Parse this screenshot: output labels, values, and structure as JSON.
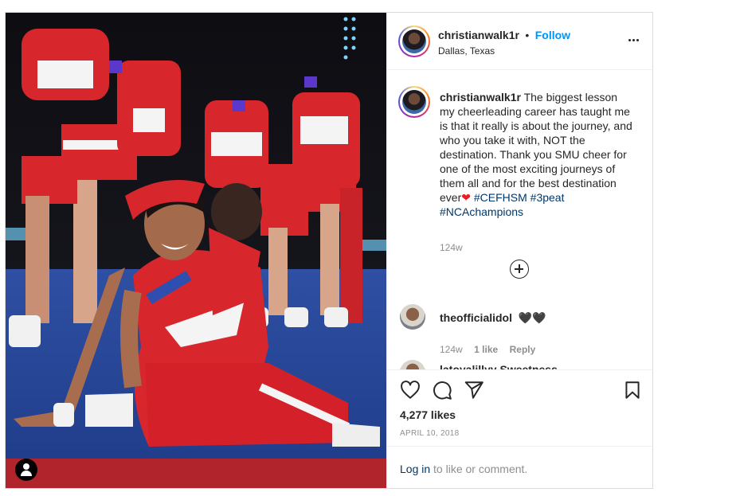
{
  "post": {
    "username": "christianwalk1r",
    "follow_label": "Follow",
    "separator": "•",
    "location": "Dallas, Texas"
  },
  "caption": {
    "username": "christianwalk1r",
    "text": "The biggest lesson my cheerleading career has taught me is that it really is about the journey, and who you take it with, NOT the destination. Thank you SMU cheer for one of the most exciting journeys of them all and for the best destination ever",
    "heart": "❤",
    "hashtags": [
      "#CEFHSM",
      "#3peat",
      "#NCAchampions"
    ],
    "time": "124w"
  },
  "comments": [
    {
      "username": "theofficialidol",
      "text": "🖤🖤",
      "time": "124w",
      "likes": "1 like",
      "reply_label": "Reply"
    }
  ],
  "next_comment_partial": "latoyalillyy Sweetness",
  "actions": {
    "likes": "4,277 likes",
    "date": "APRIL 10, 2018"
  },
  "login": {
    "link": "Log in",
    "text": " to like or comment."
  },
  "icons": [
    "heart-icon",
    "comment-icon",
    "share-icon",
    "bookmark-icon",
    "more-options-icon",
    "load-more-comments-icon",
    "user-tag-icon"
  ],
  "colors": {
    "link_blue": "#0095f6",
    "hashtag_blue": "#00376b",
    "muted": "#8e8e8e",
    "border": "#dbdbdb"
  }
}
